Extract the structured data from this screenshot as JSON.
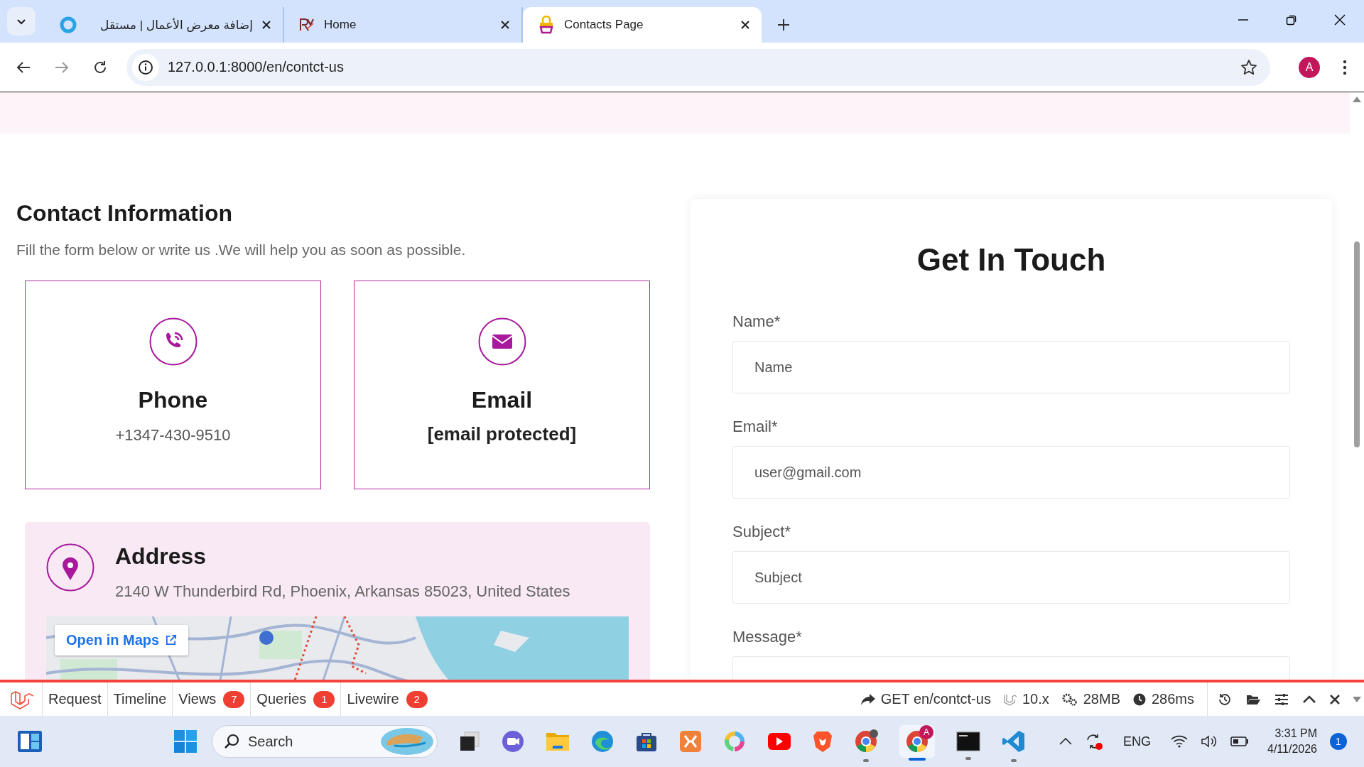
{
  "browser": {
    "tabs": [
      {
        "title": "إضافة معرض الأعمال | مستقل",
        "kind": "ring",
        "selected": false
      },
      {
        "title": "Home",
        "kind": "logo",
        "selected": false
      },
      {
        "title": "Contacts Page",
        "kind": "bag",
        "selected": true
      }
    ],
    "url": "127.0.0.1:8000/en/contct-us",
    "profile_initial": "A"
  },
  "contact_info": {
    "heading": "Contact Information",
    "subtitle": "Fill the form below or write us .We will help you as soon as possible."
  },
  "cards": [
    {
      "kind": "phone",
      "title": "Phone",
      "value": "+1347-430-9510"
    },
    {
      "kind": "email",
      "title": "Email",
      "value": "[email protected]"
    }
  ],
  "address": {
    "title": "Address",
    "text": "2140 W Thunderbird Rd, Phoenix, Arkansas 85023, United States",
    "map_button": "Open in Maps"
  },
  "form": {
    "title": "Get In Touch",
    "fields": [
      {
        "label": "Name*",
        "placeholder": "Name"
      },
      {
        "label": "Email*",
        "placeholder": "user@gmail.com"
      },
      {
        "label": "Subject*",
        "placeholder": "Subject"
      },
      {
        "label": "Message*"
      }
    ]
  },
  "debugbar": {
    "tabs": [
      {
        "label": "Request"
      },
      {
        "label": "Timeline"
      },
      {
        "label": "Views",
        "count": "7"
      },
      {
        "label": "Queries",
        "count": "1"
      },
      {
        "label": "Livewire",
        "count": "2"
      }
    ],
    "route": "GET en/contct-us",
    "version": "10.x",
    "memory": "28MB",
    "duration": "286ms"
  },
  "taskbar": {
    "search_placeholder": "Search",
    "chrome_badge": "A",
    "language": "ENG",
    "time": "3:31 PM",
    "date": "4/11/2026",
    "notifications": "1"
  }
}
